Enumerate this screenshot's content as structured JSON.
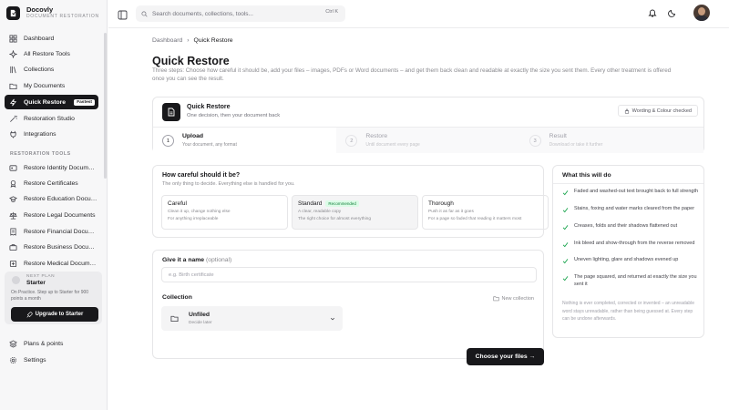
{
  "brand": {
    "name": "Docovly",
    "tagline": "DOCUMENT RESTORATION"
  },
  "sidebar": {
    "items": [
      {
        "label": "Dashboard",
        "icon": "grid-icon"
      },
      {
        "label": "All Restore Tools",
        "icon": "sparkle-icon"
      },
      {
        "label": "Collections",
        "icon": "library-icon"
      },
      {
        "label": "My Documents",
        "icon": "folder-icon"
      },
      {
        "label": "Quick Restore",
        "icon": "bolt-icon",
        "badge": "Fastest",
        "active": true
      },
      {
        "label": "Restoration Studio",
        "icon": "wand-icon"
      },
      {
        "label": "Integrations",
        "icon": "plug-icon"
      }
    ],
    "tools_label": "RESTORATION TOOLS",
    "tools": [
      {
        "label": "Restore Identity Docum…",
        "icon": "id-card-icon"
      },
      {
        "label": "Restore Certificates",
        "icon": "award-icon"
      },
      {
        "label": "Restore Education Docu…",
        "icon": "graduation-cap-icon"
      },
      {
        "label": "Restore Legal Documents",
        "icon": "scales-icon"
      },
      {
        "label": "Restore Financial Docu…",
        "icon": "receipt-icon"
      },
      {
        "label": "Restore Business Docu…",
        "icon": "briefcase-icon"
      },
      {
        "label": "Restore Medical Docum…",
        "icon": "medical-icon"
      }
    ],
    "plan": {
      "tag": "NEXT PLAN",
      "name": "Starter",
      "description": "On Practice. Step up to Starter for 900 points a month",
      "upgrade_label": "Upgrade to Starter"
    },
    "footer": [
      {
        "label": "Plans & points",
        "icon": "layers-icon"
      },
      {
        "label": "Settings",
        "icon": "gear-icon"
      }
    ]
  },
  "topbar": {
    "search_placeholder": "Search documents, collections, tools...",
    "shortcut": "Ctrl K"
  },
  "breadcrumb": {
    "parent": "Dashboard",
    "current": "Quick Restore"
  },
  "page": {
    "title": "Quick Restore",
    "description": "Three steps: Choose how careful it should be, add your files – images, PDFs or Word documents – and get them back clean and readable at exactly the size you sent them. Every other treatment is offered once you can see the result."
  },
  "quick_restore": {
    "title": "Quick Restore",
    "subtitle": "One decision, then your document back",
    "pill": "Wording & Colour checked",
    "steps": [
      {
        "num": "1",
        "title": "Upload",
        "sub": "Your document, any format"
      },
      {
        "num": "2",
        "title": "Restore",
        "sub": "Until document every page"
      },
      {
        "num": "3",
        "title": "Result",
        "sub": "Download or take it further"
      }
    ]
  },
  "care": {
    "title": "How careful should it be?",
    "subtitle": "The only thing to decide. Everything else is handled for you.",
    "options": [
      {
        "title": "Careful",
        "line1": "Clean it up, change nothing else",
        "line2": "For anything irreplaceable"
      },
      {
        "title": "Standard",
        "badge": "Recommended",
        "line1": "A clear, readable copy",
        "line2": "The right choice for almost everything"
      },
      {
        "title": "Thorough",
        "line1": "Push it as far as it goes",
        "line2": "For a page so faded that reading it matters most"
      }
    ]
  },
  "name_section": {
    "label": "Give it a name",
    "optional": "(optional)",
    "placeholder": "e.g. Birth certificate"
  },
  "collection": {
    "label": "Collection",
    "new_label": "New collection",
    "selected": "Unfiled",
    "selected_sub": "Decide later"
  },
  "choose_label": "Choose your files →",
  "what": {
    "title": "What this will do",
    "items": [
      "Faded and washed-out text brought back to full strength",
      "Stains, foxing and water marks cleared from the paper",
      "Creases, folds and their shadows flattened out",
      "Ink bleed and show-through from the reverse removed",
      "Uneven lighting, glare and shadows evened up",
      "The page squared, and returned at exactly the size you sent it"
    ],
    "note": "Nothing is ever completed, corrected or invented – an unreadable word stays unreadable, rather than being guessed at. Every step can be undone afterwards."
  },
  "colors": {
    "accent": "#18181b",
    "check": "#16a34a",
    "recommended_bg": "#dcfce7"
  }
}
